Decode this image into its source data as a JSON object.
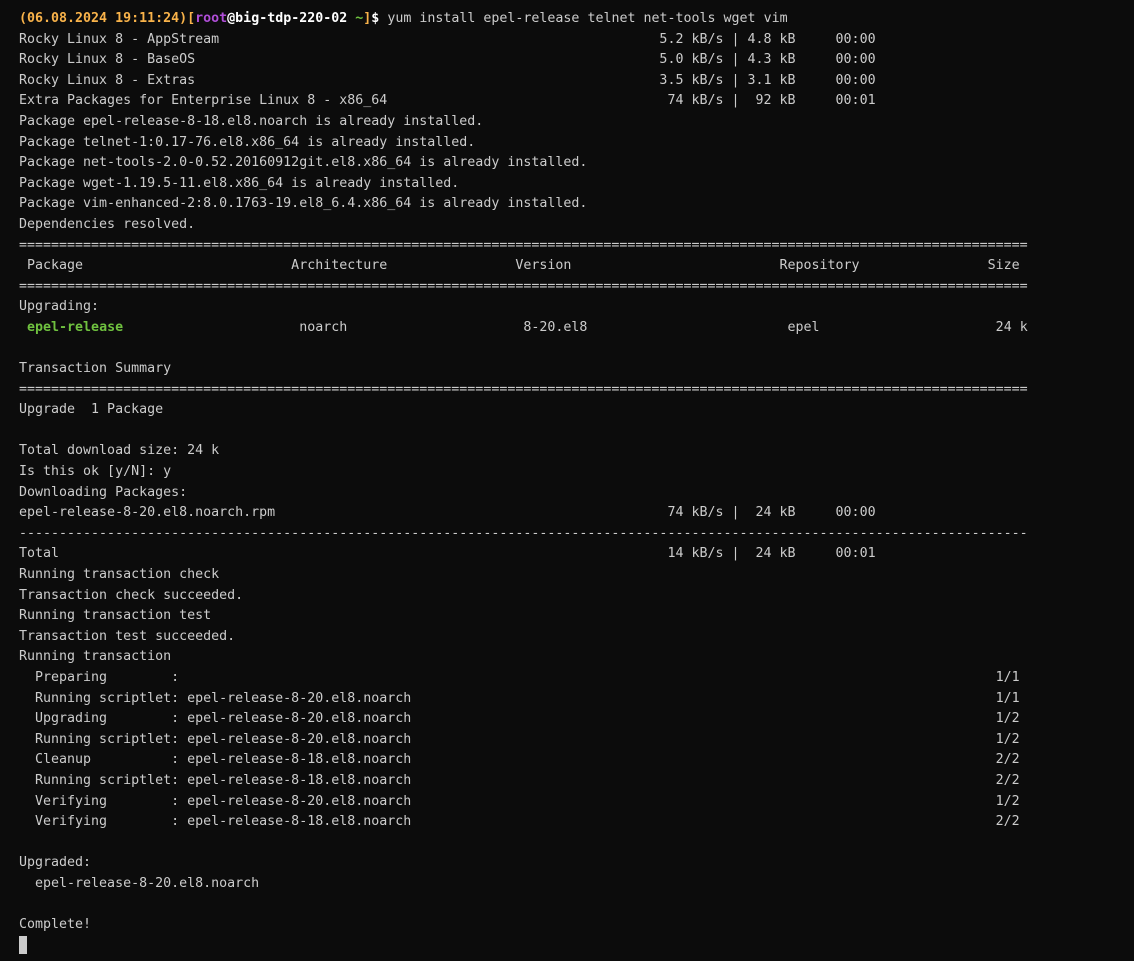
{
  "prompt": {
    "timestamp": "(06.08.2024 19:11:24)",
    "bracket_open": "[",
    "user": "root",
    "at_host": "@big-tdp-220-02",
    "space_tilde": " ~",
    "bracket_close": "]",
    "dollar": "$ ",
    "command": "yum install epel-release telnet net-tools wget vim"
  },
  "lines_before_pkg": [
    "Rocky Linux 8 - AppStream                                                       5.2 kB/s | 4.8 kB     00:00",
    "Rocky Linux 8 - BaseOS                                                          5.0 kB/s | 4.3 kB     00:00",
    "Rocky Linux 8 - Extras                                                          3.5 kB/s | 3.1 kB     00:00",
    "Extra Packages for Enterprise Linux 8 - x86_64                                   74 kB/s |  92 kB     00:01",
    "Package epel-release-8-18.el8.noarch is already installed.",
    "Package telnet-1:0.17-76.el8.x86_64 is already installed.",
    "Package net-tools-2.0-0.52.20160912git.el8.x86_64 is already installed.",
    "Package wget-1.19.5-11.el8.x86_64 is already installed.",
    "Package vim-enhanced-2:8.0.1763-19.el8_6.4.x86_64 is already installed.",
    "Dependencies resolved.",
    "==============================================================================================================================",
    " Package                          Architecture                Version                          Repository                Size",
    "==============================================================================================================================",
    "Upgrading:"
  ],
  "pkg_row": {
    "lead": " ",
    "name": "epel-release",
    "rest": "                      noarch                      8-20.el8                         epel                      24 k"
  },
  "lines_after_pkg": [
    "",
    "Transaction Summary",
    "==============================================================================================================================",
    "Upgrade  1 Package",
    "",
    "Total download size: 24 k",
    "Is this ok [y/N]: y",
    "Downloading Packages:",
    "epel-release-8-20.el8.noarch.rpm                                                 74 kB/s |  24 kB     00:00",
    "------------------------------------------------------------------------------------------------------------------------------",
    "Total                                                                            14 kB/s |  24 kB     00:01",
    "Running transaction check",
    "Transaction check succeeded.",
    "Running transaction test",
    "Transaction test succeeded.",
    "Running transaction",
    "  Preparing        :                                                                                                      1/1",
    "  Running scriptlet: epel-release-8-20.el8.noarch                                                                         1/1",
    "  Upgrading        : epel-release-8-20.el8.noarch                                                                         1/2",
    "  Running scriptlet: epel-release-8-20.el8.noarch                                                                         1/2",
    "  Cleanup          : epel-release-8-18.el8.noarch                                                                         2/2",
    "  Running scriptlet: epel-release-8-18.el8.noarch                                                                         2/2",
    "  Verifying        : epel-release-8-20.el8.noarch                                                                         1/2",
    "  Verifying        : epel-release-8-18.el8.noarch                                                                         2/2",
    "",
    "Upgraded:",
    "  epel-release-8-20.el8.noarch",
    "",
    "Complete!"
  ]
}
